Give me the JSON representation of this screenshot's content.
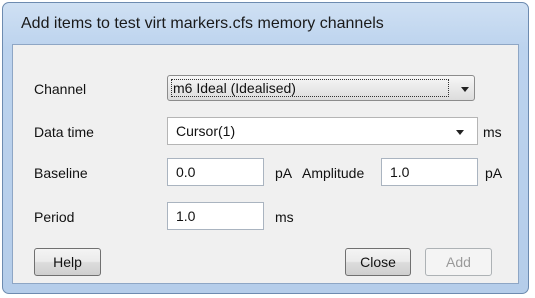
{
  "window": {
    "title": "Add items to test virt markers.cfs memory channels"
  },
  "fields": {
    "channel": {
      "label": "Channel",
      "value": "m6 Ideal (Idealised)"
    },
    "data_time": {
      "label": "Data time",
      "value": "Cursor(1)",
      "unit": "ms"
    },
    "baseline": {
      "label": "Baseline",
      "value": "0.0",
      "unit": "pA"
    },
    "amplitude": {
      "label": "Amplitude",
      "value": "1.0",
      "unit": "pA"
    },
    "period": {
      "label": "Period",
      "value": "1.0",
      "unit": "ms"
    }
  },
  "buttons": {
    "help": "Help",
    "close": "Close",
    "add": "Add"
  }
}
